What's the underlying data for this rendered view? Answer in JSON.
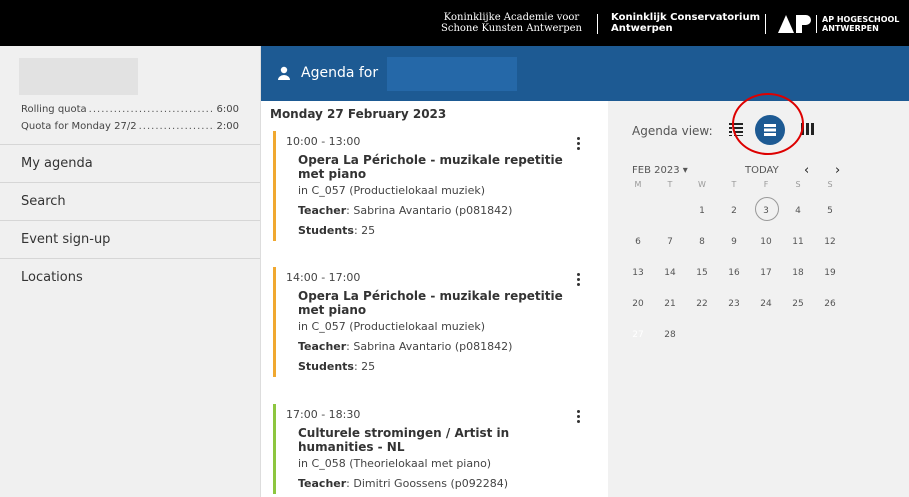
{
  "topbar": {
    "brand1_line1": "Koninklijke Academie voor",
    "brand1_line2": "Schone Kunsten Antwerpen",
    "brand2_line1": "Koninklijk Conservatorium",
    "brand2_line2": "Antwerpen",
    "ap_line1": "AP HOGESCHOOL",
    "ap_line2": "ANTWERPEN"
  },
  "sidebar": {
    "quota": [
      {
        "label": "Rolling quota",
        "value": "6:00"
      },
      {
        "label": "Quota for Monday 27/2",
        "value": "2:00"
      }
    ],
    "items": [
      {
        "label": "My agenda"
      },
      {
        "label": "Search"
      },
      {
        "label": "Event sign-up"
      },
      {
        "label": "Locations"
      }
    ]
  },
  "header": {
    "title": "Agenda for",
    "icon": "person-icon"
  },
  "agenda": {
    "date": "Monday 27 February 2023",
    "events": [
      {
        "time": "10:00 - 13:00",
        "title": "Opera La Périchole - muzikale repetitie met piano",
        "location": "in C_057 (Productielokaal muziek)",
        "teacher_label": "Teacher",
        "teacher": ": Sabrina Avantario (p081842)",
        "students_label": "Students",
        "students": ": 25",
        "color": "#f0a830"
      },
      {
        "time": "14:00 - 17:00",
        "title": "Opera La Périchole - muzikale repetitie met piano",
        "location": "in C_057 (Productielokaal muziek)",
        "teacher_label": "Teacher",
        "teacher": ": Sabrina Avantario (p081842)",
        "students_label": "Students",
        "students": ": 25",
        "color": "#f0a830"
      },
      {
        "time": "17:00 - 18:30",
        "title": "Culturele stromingen / Artist in humanities - NL",
        "location": "in C_058 (Theorielokaal met piano)",
        "teacher_label": "Teacher",
        "teacher": ": Dimitri Goossens (p092284)",
        "color": "#8dc63f"
      }
    ]
  },
  "calendar": {
    "view_label": "Agenda view:",
    "month": "FEB 2023",
    "today": "TODAY",
    "prev": "‹",
    "next": "›",
    "dow": [
      "M",
      "T",
      "W",
      "T",
      "F",
      "S",
      "S"
    ],
    "weeks": [
      [
        "",
        "",
        "1",
        "2",
        "3",
        "4",
        "5"
      ],
      [
        "6",
        "7",
        "8",
        "9",
        "10",
        "11",
        "12"
      ],
      [
        "13",
        "14",
        "15",
        "16",
        "17",
        "18",
        "19"
      ],
      [
        "20",
        "21",
        "22",
        "23",
        "24",
        "25",
        "26"
      ],
      [
        "27",
        "28",
        "",
        "",
        "",
        "",
        ""
      ]
    ],
    "today_day": "3",
    "selected_day": "27",
    "accent": "#1d5a93"
  }
}
